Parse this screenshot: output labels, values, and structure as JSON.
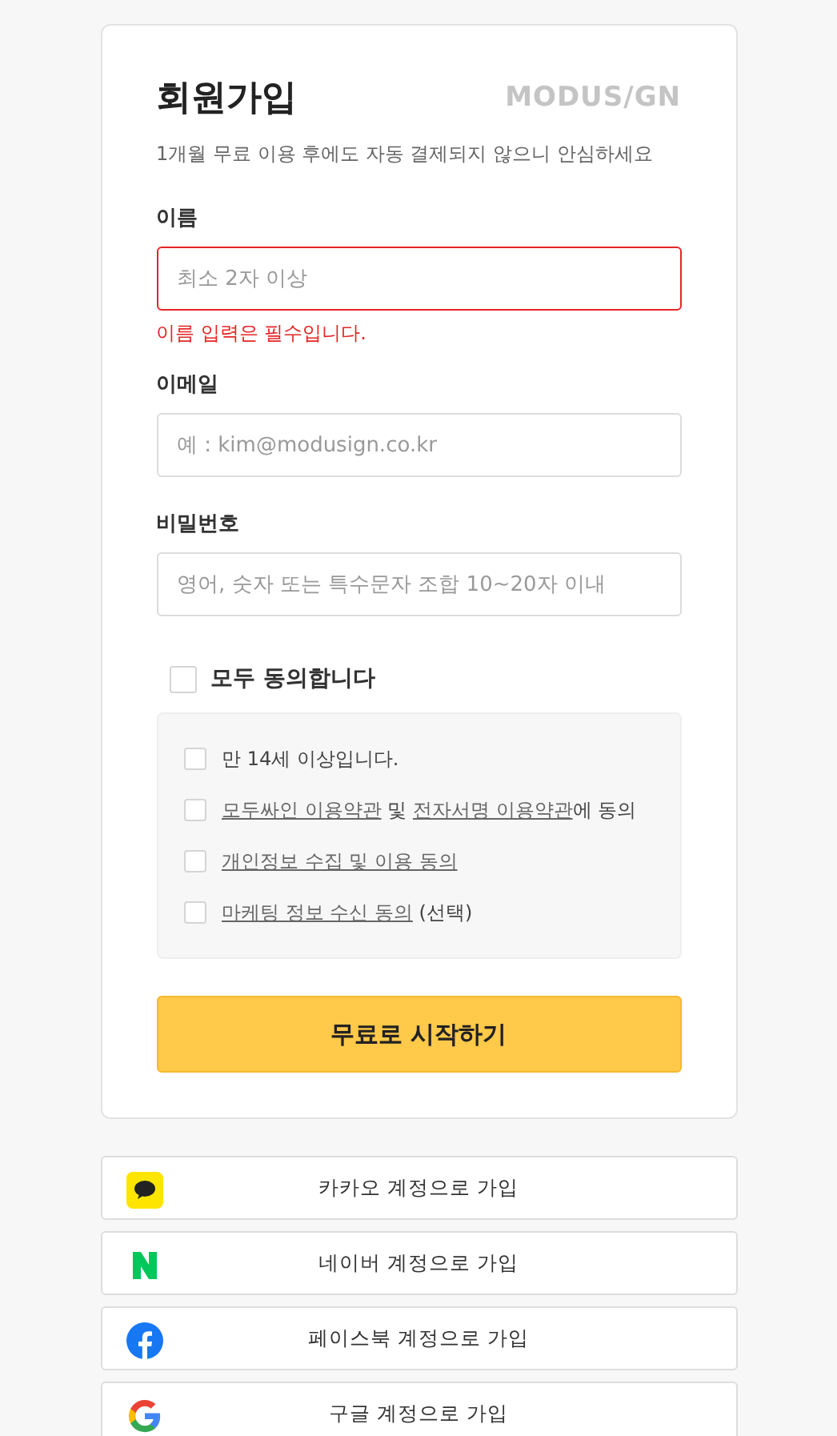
{
  "title": "회원가입",
  "brand": "MODUS/GN",
  "subtitle": "1개월 무료 이용 후에도 자동 결제되지 않으니 안심하세요",
  "fields": [
    {
      "label": "이름",
      "placeholder": "최소 2자 이상",
      "invalid": true,
      "error": "이름 입력은 필수입니다."
    },
    {
      "label": "이메일",
      "placeholder": "예 : kim@modusign.co.kr",
      "invalid": false
    },
    {
      "label": "비밀번호",
      "placeholder": "영어, 숫자 또는 특수문자 조합 10~20자 이내",
      "invalid": false
    }
  ],
  "agree_all": {
    "label": "모두 동의합니다",
    "checked": false
  },
  "terms": [
    {
      "checked": false,
      "parts": [
        {
          "text": "만 14세 이상입니다.",
          "link": false
        }
      ]
    },
    {
      "checked": false,
      "parts": [
        {
          "text": "모두싸인 이용약관",
          "link": true
        },
        {
          "text": " 및 ",
          "link": false
        },
        {
          "text": "전자서명 이용약관",
          "link": true
        },
        {
          "text": "에 동의",
          "link": false
        }
      ]
    },
    {
      "checked": false,
      "parts": [
        {
          "text": "개인정보 수집 및 이용 동의",
          "link": true
        }
      ]
    },
    {
      "checked": false,
      "parts": [
        {
          "text": "마케팅 정보 수신 동의",
          "link": true
        },
        {
          "text": " (선택)",
          "link": false
        }
      ]
    }
  ],
  "submit": "무료로 시작하기",
  "social": [
    {
      "kind": "kakao",
      "label": "카카오 계정으로 가입"
    },
    {
      "kind": "naver",
      "label": "네이버 계정으로 가입"
    },
    {
      "kind": "facebook",
      "label": "페이스북 계정으로 가입"
    },
    {
      "kind": "google",
      "label": "구글 계정으로 가입"
    }
  ]
}
